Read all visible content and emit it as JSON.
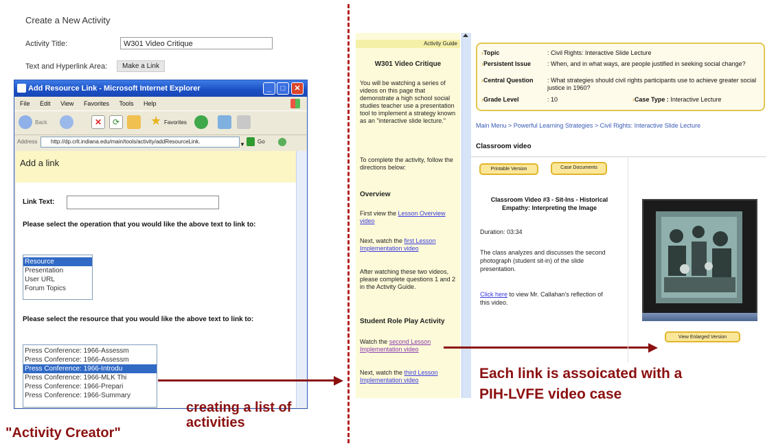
{
  "activity_form": {
    "heading": "Create a New Activity",
    "title_label": "Activity Title:",
    "title_value": "W301 Video Critique",
    "text_area_label": "Text and Hyperlink Area:",
    "make_link_button": "Make a Link"
  },
  "ie_window": {
    "title": "Add Resource Link - Microsoft Internet Explorer",
    "menu": [
      "File",
      "Edit",
      "View",
      "Favorites",
      "Tools",
      "Help"
    ],
    "toolbar": {
      "back": "Back",
      "favorites": "Favorites"
    },
    "address_label": "Address",
    "address_value": "http://dp.crlt.indiana.edu/main/tools/activity/addResourceLink.",
    "go_label": "Go"
  },
  "add_link": {
    "heading": "Add a link",
    "link_text_label": "Link Text:",
    "operation_prompt": "Please select the operation that you would like the above text to link to:",
    "operations": [
      "Resource",
      "Presentation",
      "User URL",
      "Forum Topics"
    ],
    "resource_prompt": "Please select the resource that you would like the above text to link to:",
    "resources": [
      "Press Conference: 1966-Assessm",
      "Press Conference: 1966-Assessm",
      "Press Conference: 1966-Introdu",
      "Press Conference: 1966-MLK Thi",
      "Press Conference: 1966-Prepari",
      "Press Conference: 1966-Summary"
    ]
  },
  "annotations": {
    "activity_creator": "\"Activity Creator\"",
    "creating_list": [
      "creating a list of",
      "activities"
    ],
    "each_link": [
      "Each link is assoicated with a",
      "PIH-LVFE video case"
    ]
  },
  "guide": {
    "header": "Activity Guide",
    "title": "W301 Video Critique",
    "intro": "You will be watching a series of videos on this page that demonstrate a high school social studies teacher use a presentation tool to implement a strategy known as an \"interactive slide lecture.\"",
    "complete": "To complete the activity, follow the directions below:",
    "overview_heading": "Overview",
    "first_prefix": "First view the ",
    "first_link": "Lesson Overview video",
    "next_prefix": "Next, watch the ",
    "next_link": "first Lesson Implementation video",
    "after": "After watching these two videos, please complete questions 1 and 2 in the Activity Guide.",
    "role_play_heading": "Student Role Play Activity",
    "watch_prefix": "Watch the ",
    "watch_link": "second Lesson Implementation video",
    "next2_prefix": "Next, watch the ",
    "next2_link": "third Lesson Implementation video"
  },
  "case_info": {
    "topic_label": "Topic",
    "topic_value": ": Civil Rights: Interactive Slide Lecture",
    "issue_label": "Persistent Issue",
    "issue_value": ": When, and in what ways, are people justified in seeking social change?",
    "question_label": "Central Question",
    "question_value": ": What strategies should civil rights participants use to achieve greater social justice in 1960?",
    "grade_label": "Grade Level",
    "grade_value": ": 10",
    "case_type_label": "Case Type :",
    "case_type_value": "Interactive Lecture"
  },
  "breadcrumb": "Main Menu > Powerful Learning Strategies > Civil Rights: Interactive Slide Lecture",
  "classroom": {
    "heading": "Classroom video",
    "printable_button": "Printable Version",
    "case_docs_button": "Case Documents",
    "video_title": "Classroom Video #3 - Sit-Ins - Historical Empathy: Interpreting the Image",
    "duration": "Duration: 03:34",
    "description": "The class analyzes and discusses the second photograph (student sit-in) of the slide presentation.",
    "click_link": "Click here",
    "click_rest": " to view Mr. Callahan's reflection of this video.",
    "enlarged_button": "View Enlarged Version"
  },
  "colors": {
    "accent": "#8b1010",
    "xp_blue": "#1b4fc4",
    "guide_bg": "#fcfad8",
    "info_border": "#e1c74e"
  }
}
